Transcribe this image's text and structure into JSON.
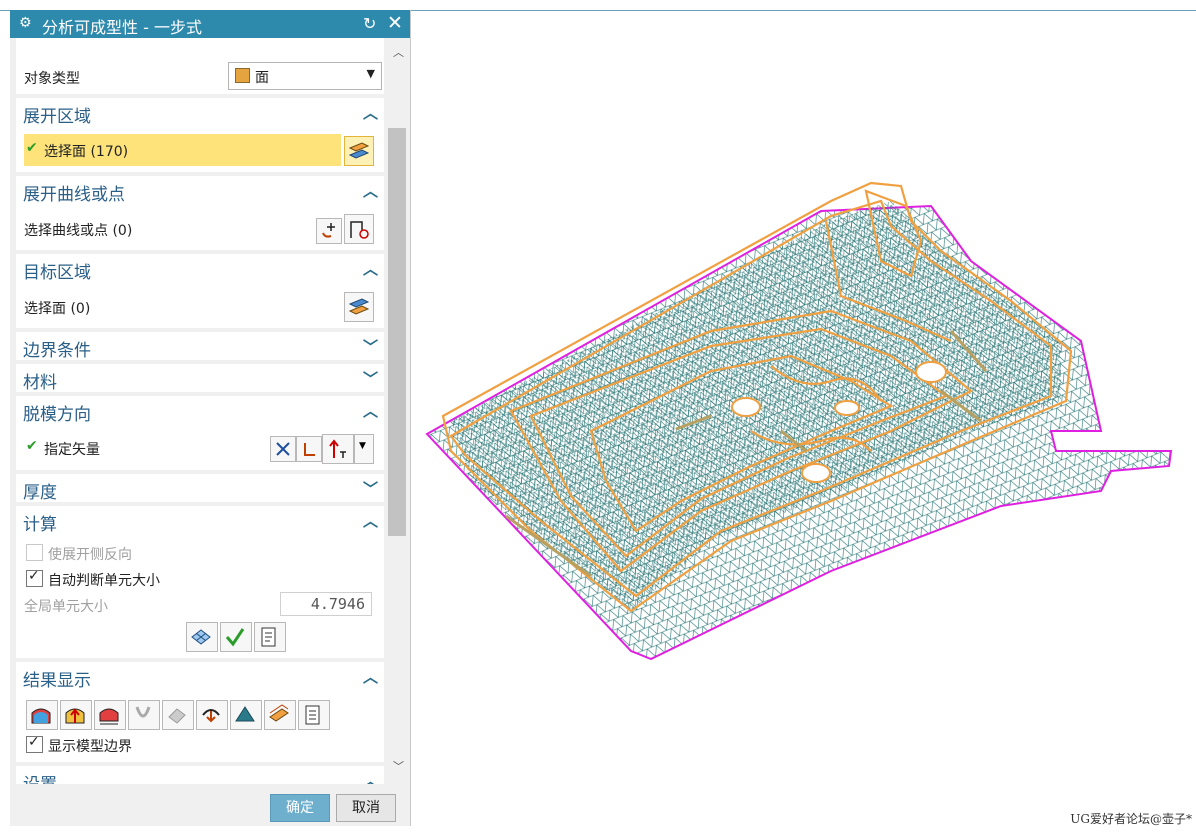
{
  "dialog": {
    "title": "分析可成型性 - 一步式",
    "object_type": {
      "label": "对象类型",
      "value": "面"
    },
    "sections": {
      "unfold_region": {
        "title": "展开区域",
        "select_label": "选择面 (170)"
      },
      "unfold_curves": {
        "title": "展开曲线或点",
        "select_label": "选择曲线或点 (0)"
      },
      "target_region": {
        "title": "目标区域",
        "select_label": "选择面 (0)"
      },
      "boundary": {
        "title": "边界条件"
      },
      "material": {
        "title": "材料"
      },
      "draft": {
        "title": "脱模方向",
        "vector_label": "指定矢量"
      },
      "thickness": {
        "title": "厚度"
      },
      "compute": {
        "title": "计算",
        "reverse_label": "使展开侧反向",
        "auto_size_label": "自动判断单元大小",
        "global_size_label": "全局单元大小",
        "global_size_value": "4.7946"
      },
      "results": {
        "title": "结果显示",
        "show_boundary_label": "显示模型边界"
      },
      "settings": {
        "title": "设置"
      }
    },
    "ok_label": "确定",
    "cancel_label": "取消"
  },
  "watermark": "UG爱好者论坛@壶子*",
  "colors": {
    "title_bar": "#2e8aad",
    "highlight": "#fde37a",
    "mesh": "#1f6f6f",
    "edge": "#f0a040",
    "boundary": "#e020e0"
  }
}
